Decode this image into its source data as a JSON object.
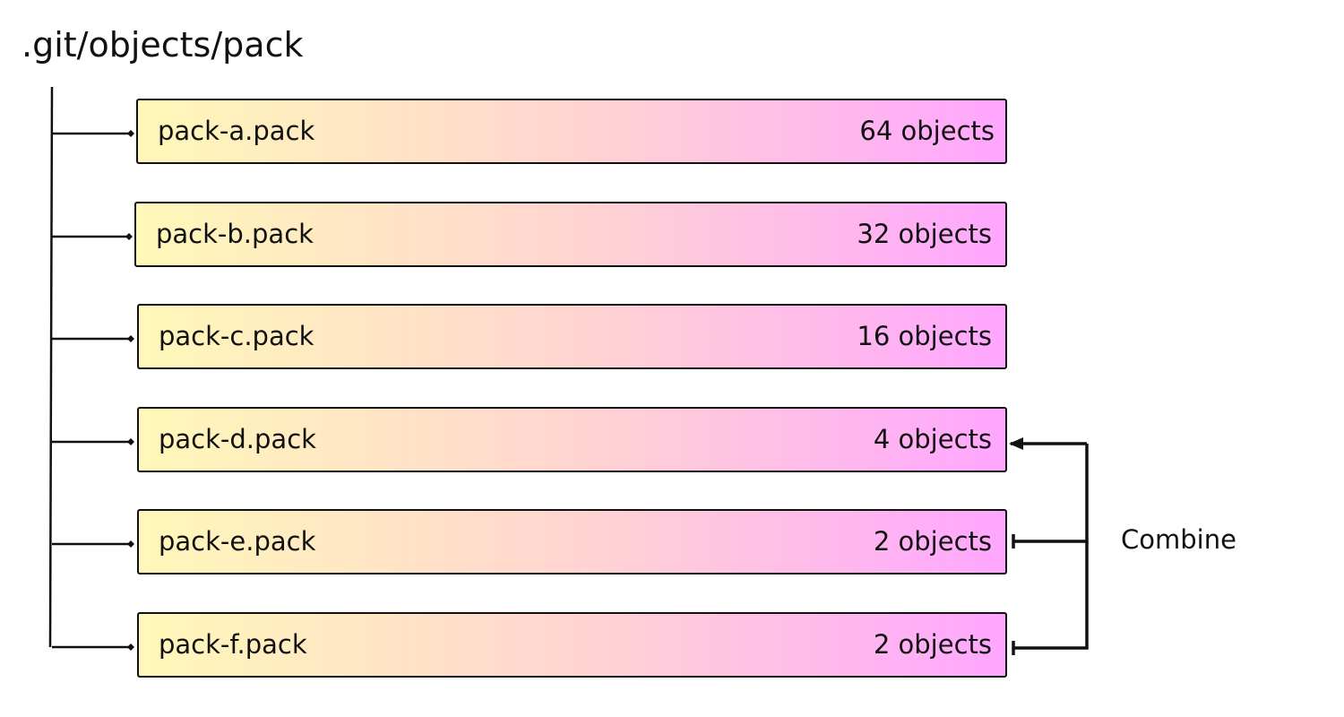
{
  "directory": {
    "path": ".git/objects/pack"
  },
  "colors": {
    "gradient_start": "#fff8b8",
    "gradient_mid": "#ffd5d0",
    "gradient_end": "#ffa6ff",
    "line": "#111111"
  },
  "packs": [
    {
      "name": "pack-a.pack",
      "count": "64 objects"
    },
    {
      "name": "pack-b.pack",
      "count": "32 objects"
    },
    {
      "name": "pack-c.pack",
      "count": "16 objects"
    },
    {
      "name": "pack-d.pack",
      "count": "4 objects"
    },
    {
      "name": "pack-e.pack",
      "count": "2 objects"
    },
    {
      "name": "pack-f.pack",
      "count": "2 objects"
    }
  ],
  "combine": {
    "label": "Combine",
    "sources": [
      "pack-e.pack",
      "pack-f.pack"
    ],
    "target": "pack-d.pack"
  }
}
